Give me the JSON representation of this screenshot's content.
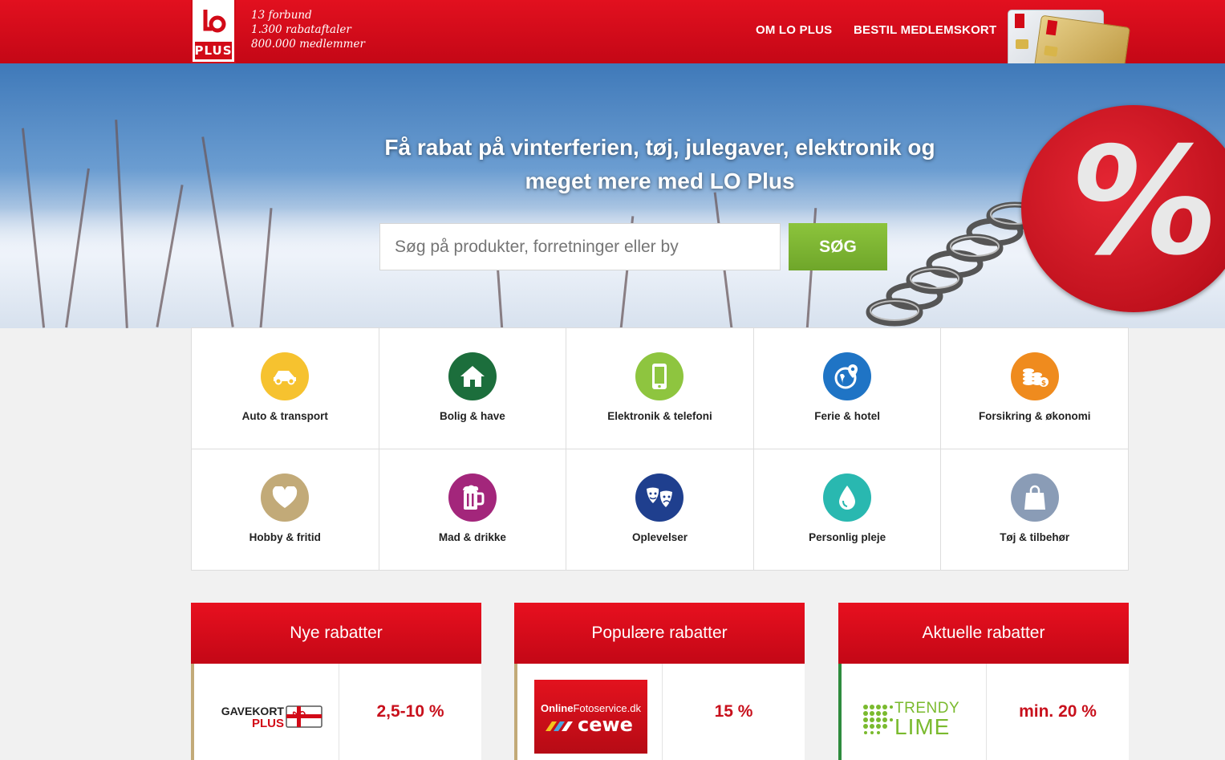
{
  "header": {
    "logo": {
      "lo": "lo",
      "plus": "PLUS"
    },
    "tagline": [
      "13 forbund",
      "1.300 rabataftaler",
      "800.000 medlemmer"
    ],
    "nav": {
      "om": "OM LO PLUS",
      "bestil": "BESTIL MEDLEMSKORT"
    }
  },
  "hero": {
    "title_line1": "Få rabat på vinterferien, tøj, julegaver, elektronik og",
    "title_line2": "meget mere med LO Plus",
    "search": {
      "placeholder": "Søg på produkter, forretninger eller by",
      "button": "SØG"
    },
    "badge_symbol": "%"
  },
  "categories": [
    {
      "label": "Auto & transport",
      "icon": "car-icon",
      "color": "#f6c22f"
    },
    {
      "label": "Bolig & have",
      "icon": "house-icon",
      "color": "#1c6e3c"
    },
    {
      "label": "Elektronik & telefoni",
      "icon": "phone-icon",
      "color": "#8ec53f"
    },
    {
      "label": "Ferie & hotel",
      "icon": "globe-pin-icon",
      "color": "#1f74c5"
    },
    {
      "label": "Forsikring & økonomi",
      "icon": "coins-icon",
      "color": "#ef8b1e"
    },
    {
      "label": "Hobby & fritid",
      "icon": "heart-icon",
      "color": "#c2aa78"
    },
    {
      "label": "Mad & drikke",
      "icon": "beer-mug-icon",
      "color": "#a3267b"
    },
    {
      "label": "Oplevelser",
      "icon": "theater-masks-icon",
      "color": "#1f3f8e"
    },
    {
      "label": "Personlig pleje",
      "icon": "drop-icon",
      "color": "#29b8b0"
    },
    {
      "label": "Tøj & tilbehør",
      "icon": "shopping-bag-icon",
      "color": "#8a9cb6"
    }
  ],
  "panels": [
    {
      "title": "Nye rabatter",
      "value": "2,5-10 %",
      "logo": {
        "line1": "GAVEKORT",
        "line2": "PLUS"
      },
      "accent": "#c2aa78"
    },
    {
      "title": "Populære rabatter",
      "value": "15 %",
      "logo": {
        "line1a": "Online",
        "line1b": "Fotoservice.dk",
        "line2": "cewe"
      },
      "accent": "#c2aa78"
    },
    {
      "title": "Aktuelle rabatter",
      "value": "min. 20 %",
      "logo": {
        "line1": "TRENDY",
        "line2": "LIME"
      },
      "accent": "#2e8b3e"
    }
  ]
}
